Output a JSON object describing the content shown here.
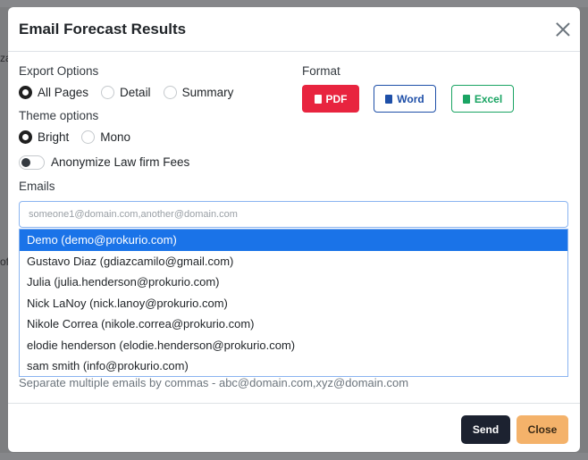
{
  "background": {
    "fragments": [
      "za",
      "of"
    ]
  },
  "modal": {
    "title": "Email Forecast Results"
  },
  "export_options": {
    "label": "Export Options",
    "options": [
      {
        "label": "All Pages",
        "checked": true
      },
      {
        "label": "Detail",
        "checked": false
      },
      {
        "label": "Summary",
        "checked": false
      }
    ]
  },
  "format": {
    "label": "Format",
    "pdf_label": "PDF",
    "word_label": "Word",
    "excel_label": "Excel",
    "colors": {
      "pdf": "#e8243f",
      "word": "#1e4fa8",
      "excel": "#1aa463"
    }
  },
  "theme_options": {
    "label": "Theme options",
    "options": [
      {
        "label": "Bright",
        "checked": true
      },
      {
        "label": "Mono",
        "checked": false
      }
    ]
  },
  "anonymize": {
    "label": "Anonymize Law firm Fees",
    "enabled": false
  },
  "emails": {
    "label": "Emails",
    "placeholder": "someone1@domain.com,another@domain.com",
    "value": "",
    "suggestions": [
      "Demo (demo@prokurio.com)",
      "Gustavo Diaz (gdiazcamilo@gmail.com)",
      "Julia (julia.henderson@prokurio.com)",
      "Nick LaNoy (nick.lanoy@prokurio.com)",
      "Nikole Correa (nikole.correa@prokurio.com)",
      "elodie henderson (elodie.henderson@prokurio.com)",
      "sam smith (info@prokurio.com)"
    ],
    "selected_suggestion": "Demo (demo@prokurio.com)",
    "help_text": "Separate multiple emails by commas - abc@domain.com,xyz@domain.com"
  },
  "footer": {
    "send_label": "Send",
    "close_label": "Close"
  }
}
